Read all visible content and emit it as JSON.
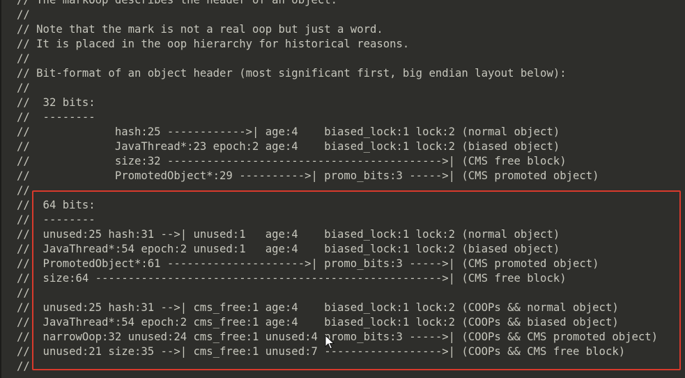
{
  "editor": {
    "lines": [
      "// The markOop describes the header of an object.",
      "//",
      "// Note that the mark is not a real oop but just a word.",
      "// It is placed in the oop hierarchy for historical reasons.",
      "//",
      "// Bit-format of an object header (most significant first, big endian layout below):",
      "//",
      "//  32 bits:",
      "//  --------",
      "//             hash:25 ------------>| age:4    biased_lock:1 lock:2 (normal object)",
      "//             JavaThread*:23 epoch:2 age:4    biased_lock:1 lock:2 (biased object)",
      "//             size:32 ------------------------------------------>| (CMS free block)",
      "//             PromotedObject*:29 ---------->| promo_bits:3 ----->| (CMS promoted object)",
      "//",
      "//  64 bits:",
      "//  --------",
      "//  unused:25 hash:31 -->| unused:1   age:4    biased_lock:1 lock:2 (normal object)",
      "//  JavaThread*:54 epoch:2 unused:1   age:4    biased_lock:1 lock:2 (biased object)",
      "//  PromotedObject*:61 --------------------->| promo_bits:3 ----->| (CMS promoted object)",
      "//  size:64 ----------------------------------------------------->| (CMS free block)",
      "//",
      "//  unused:25 hash:31 -->| cms_free:1 age:4    biased_lock:1 lock:2 (COOPs && normal object)",
      "//  JavaThread*:54 epoch:2 cms_free:1 age:4    biased_lock:1 lock:2 (COOPs && biased object)",
      "//  narrowOop:32 unused:24 cms_free:1 unused:4 promo_bits:3 ----->| (COOPs && CMS promoted object)",
      "//  unused:21 size:35 -->| cms_free:1 unused:7 ------------------>| (COOPs && CMS free block)",
      "//"
    ]
  },
  "colors": {
    "background": "#2e2e2b",
    "text": "#c7c7bd",
    "highlight_border": "#d93a2c"
  }
}
